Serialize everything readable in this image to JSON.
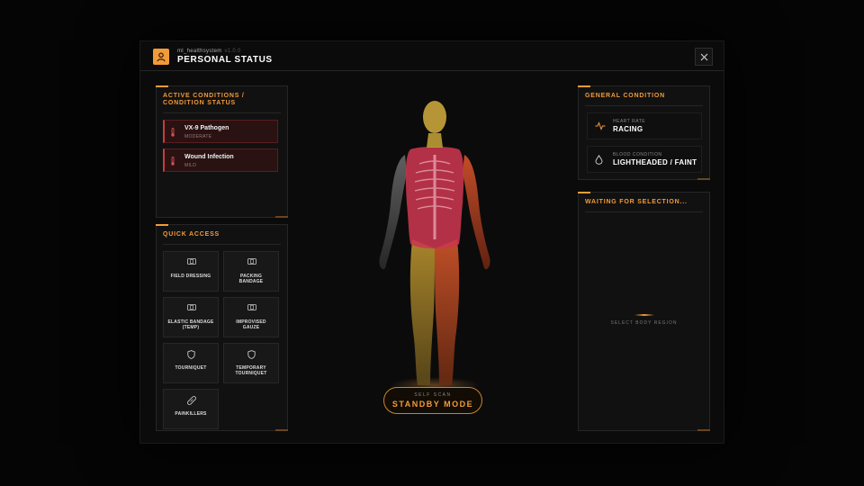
{
  "header": {
    "subtitle": "ml_healthsystem",
    "version": "v1.0.0",
    "title": "PERSONAL STATUS"
  },
  "conditions": {
    "title": "ACTIVE CONDITIONS / CONDITION STATUS",
    "items": [
      {
        "name": "VX-9 Pathogen",
        "severity": "MODERATE"
      },
      {
        "name": "Wound Infection",
        "severity": "MILD"
      }
    ]
  },
  "quick_access": {
    "title": "QUICK ACCESS",
    "items": [
      {
        "label": "FIELD DRESSING",
        "icon": "bandage-icon"
      },
      {
        "label": "PACKING BANDAGE",
        "icon": "bandage-icon"
      },
      {
        "label": "ELASTIC BANDAGE (TEMP)",
        "icon": "bandage-icon"
      },
      {
        "label": "IMPROVISED GAUZE",
        "icon": "bandage-icon"
      },
      {
        "label": "TOURNIQUET",
        "icon": "shield-icon"
      },
      {
        "label": "TEMPORARY TOURNIQUET",
        "icon": "shield-icon"
      },
      {
        "label": "PAINKILLERS",
        "icon": "pill-icon"
      }
    ]
  },
  "scan": {
    "label": "SELF SCAN",
    "mode": "STANDBY MODE"
  },
  "general_condition": {
    "title": "GENERAL CONDITION",
    "heart_rate": {
      "label": "HEART RATE",
      "value": "RACING",
      "icon": "heartbeat-icon"
    },
    "blood_condition": {
      "label": "BLOOD CONDITION",
      "value": "LIGHTHEADED / FAINT",
      "icon": "blood-drop-icon"
    }
  },
  "selection": {
    "title": "WAITING FOR SELECTION...",
    "hint": "SELECT BODY REGION"
  },
  "colors": {
    "accent": "#f29b3a",
    "critical": "#d23c55",
    "warning": "#c8a43a",
    "injured": "#d2502a"
  }
}
